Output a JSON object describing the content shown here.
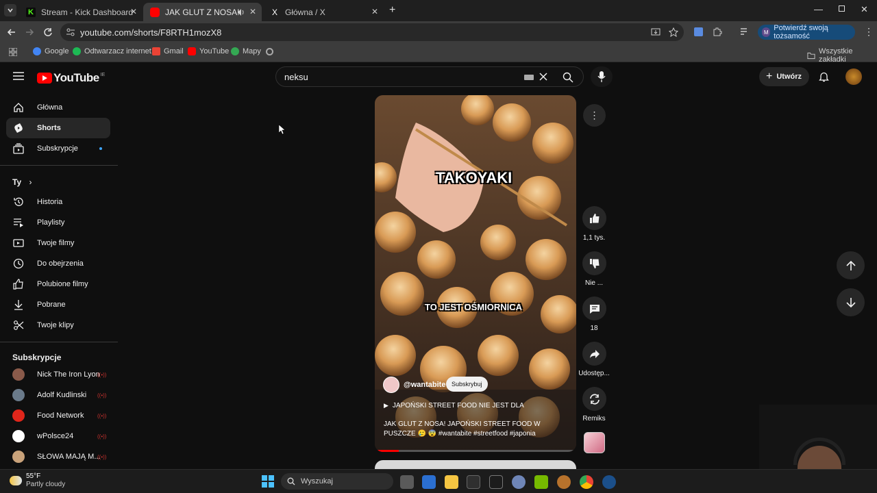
{
  "browser": {
    "tabs": [
      {
        "title": "Stream - Kick Dashboard",
        "favicon_color": "#53fc18",
        "favicon_letter": "K"
      },
      {
        "title": "JAK GLUT Z NOSA! JAPOŃS",
        "favicon_color": "#ff0000"
      },
      {
        "title": "Główna / X",
        "favicon_letter": "X"
      }
    ],
    "url": "youtube.com/shorts/F8RTH1mozX8",
    "verify_identity": "Potwierdź swoją tożsamość",
    "profile_initial": "M",
    "bookmarks": [
      {
        "label": "Google",
        "color": "#4285f4"
      },
      {
        "label": "Odtwarzacz internet...",
        "color": "#1db954"
      },
      {
        "label": "Gmail",
        "color": "#ea4335"
      },
      {
        "label": "YouTube",
        "color": "#ff0000"
      },
      {
        "label": "Mapy",
        "color": "#34a853"
      }
    ],
    "all_bookmarks": "Wszystkie zakładki"
  },
  "youtube": {
    "logo_text": "YouTube",
    "country_code": "IE",
    "search_value": "neksu",
    "create_label": "Utwórz",
    "sidebar": {
      "main": [
        {
          "label": "Główna",
          "icon": "home-icon"
        },
        {
          "label": "Shorts",
          "icon": "shorts-icon",
          "active": true
        },
        {
          "label": "Subskrypcje",
          "icon": "subscriptions-icon"
        }
      ],
      "you_title": "Ty",
      "you": [
        {
          "label": "Historia",
          "icon": "history-icon"
        },
        {
          "label": "Playlisty",
          "icon": "playlist-icon"
        },
        {
          "label": "Twoje filmy",
          "icon": "video-icon"
        },
        {
          "label": "Do obejrzenia",
          "icon": "clock-icon"
        },
        {
          "label": "Polubione filmy",
          "icon": "like-icon"
        },
        {
          "label": "Pobrane",
          "icon": "download-icon"
        },
        {
          "label": "Twoje klipy",
          "icon": "scissors-icon"
        }
      ],
      "subs_title": "Subskrypcje",
      "subs": [
        {
          "label": "Nick The Iron Lyon",
          "color": "#8a5a4a"
        },
        {
          "label": "Adolf Kudlinski",
          "color": "#6a7a8a"
        },
        {
          "label": "Food Network",
          "color": "#e0261b"
        },
        {
          "label": "wPolsce24",
          "color": "#ffffff"
        },
        {
          "label": "SŁOWA MAJĄ M...",
          "color": "#c9a27a"
        }
      ]
    },
    "short": {
      "overlay_title": "TAKOYAKI",
      "overlay_subtitle": "TO JEST OŚMIORNICA",
      "channel": "@wantabite",
      "subscribe_label": "Subskrybuj",
      "related": "JAPOŃSKI STREET FOOD NIE JEST DLA",
      "description": "JAK GLUT Z NOSA! JAPOŃSKI STREET FOOD W PUSZCZE 🥲 😨 #wantabite #streetfood #japonia",
      "progress": 0.12
    },
    "actions": {
      "likes": "1,1 tys.",
      "dislike": "Nie ...",
      "comments": "18",
      "share": "Udostęp...",
      "remix": "Remiks"
    }
  },
  "taskbar": {
    "temperature": "55°F",
    "weather": "Partly cloudy",
    "search_placeholder": "Wyszukaj"
  }
}
